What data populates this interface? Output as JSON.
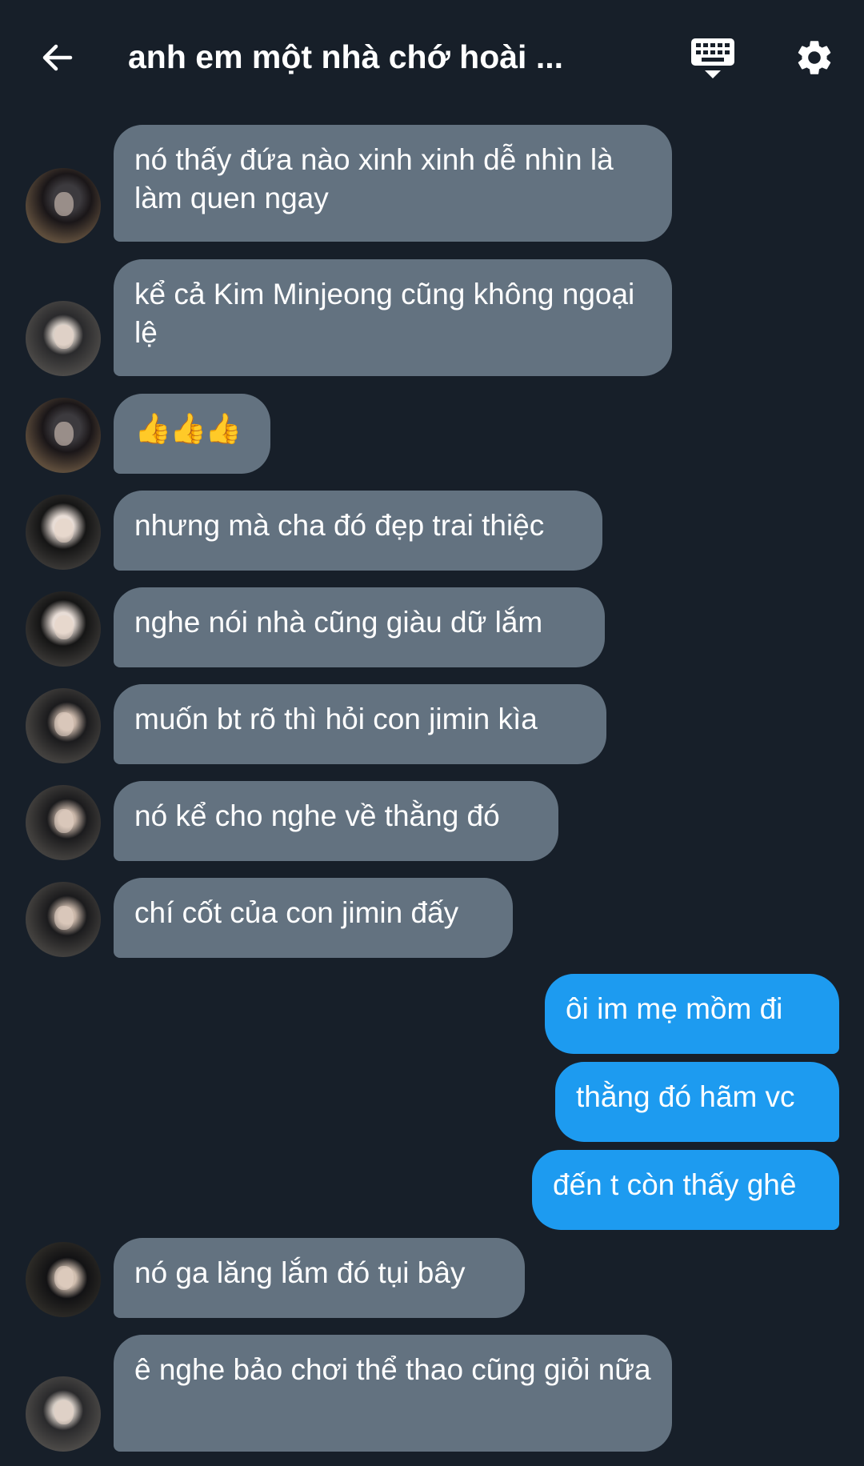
{
  "header": {
    "title": "anh em một nhà chớ hoài ...",
    "back_icon": "back-arrow-icon",
    "keyboard_icon": "keyboard-icon",
    "settings_icon": "gear-icon"
  },
  "colors": {
    "background": "#171f29",
    "incoming_bubble": "#637280",
    "outgoing_bubble": "#1d9bf0",
    "text": "#ffffff"
  },
  "messages": [
    {
      "sender": "other",
      "text": "nó thấy đứa nào xinh xinh dễ nhìn là làm quen ngay"
    },
    {
      "sender": "other",
      "text": "kể cả Kim Minjeong cũng không ngoại lệ"
    },
    {
      "sender": "other",
      "text": "👍👍👍"
    },
    {
      "sender": "other",
      "text": "nhưng mà cha đó đẹp trai thiệc"
    },
    {
      "sender": "other",
      "text": "nghe nói nhà cũng giàu dữ lắm"
    },
    {
      "sender": "other",
      "text": "muốn bt rõ thì hỏi con jimin kìa"
    },
    {
      "sender": "other",
      "text": "nó kể cho nghe về thằng đó"
    },
    {
      "sender": "other",
      "text": "chí cốt của con jimin đấy"
    },
    {
      "sender": "me",
      "text": "ôi im mẹ mồm đi"
    },
    {
      "sender": "me",
      "text": "thằng đó hãm vc"
    },
    {
      "sender": "me",
      "text": "đến t còn thấy ghê"
    },
    {
      "sender": "other",
      "text": "nó ga lăng lắm đó tụi bây"
    },
    {
      "sender": "other",
      "text": "ê nghe bảo chơi thể thao cũng giỏi nữa"
    }
  ]
}
